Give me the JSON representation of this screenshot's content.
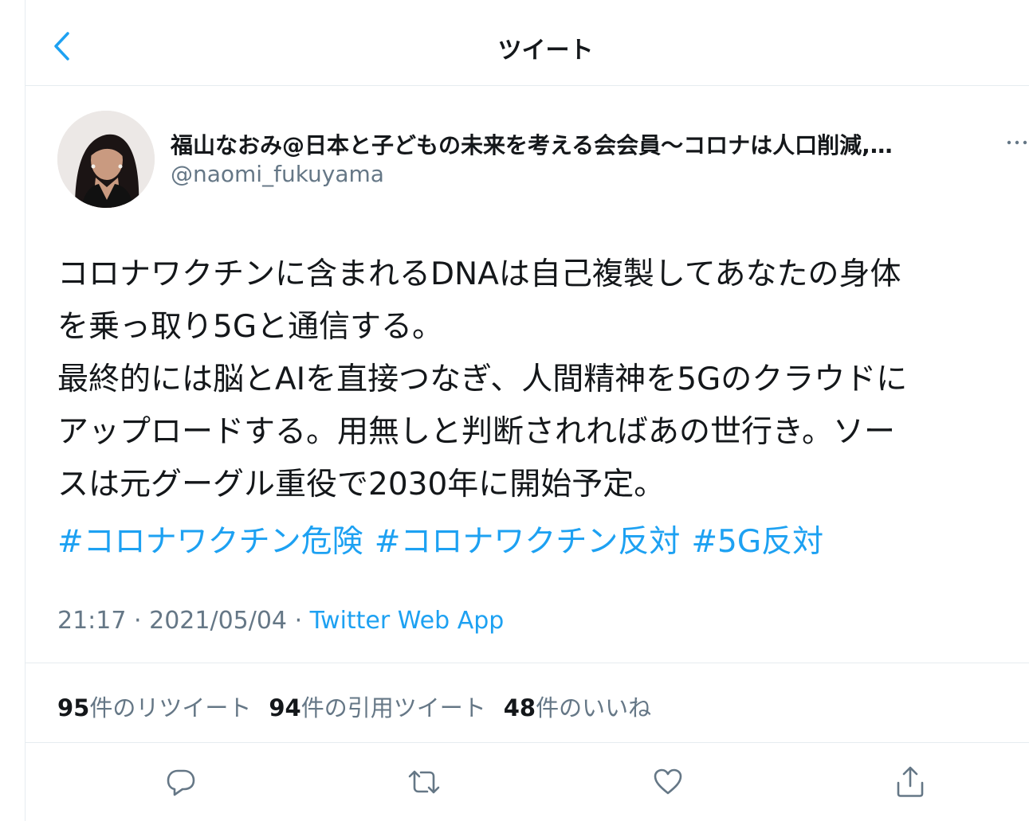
{
  "header": {
    "title": "ツイート",
    "back_icon": "chevron-left-icon"
  },
  "author": {
    "display_name": "福山なおみ@日本と子どもの未来を考える会会員〜コロナは人口削減,…",
    "handle": "@naomi_fukuyama",
    "more_icon": "more-dots-icon"
  },
  "tweet": {
    "lines": [
      "コロナワクチンに含まれるDNAは自己複製してあなたの身体",
      "を乗っ取り5Gと通信する。",
      "最終的には脳とAIを直接つなぎ、人間精神を5Gのクラウドに",
      "アップロードする。用無しと判断されればあの世行き。ソー",
      "スは元グーグル重役で2030年に開始予定。"
    ],
    "hashtags": [
      "#コロナワクチン危険",
      "#コロナワクチン反対",
      "#5G反対"
    ],
    "time": "21:17",
    "date": "2021/05/04",
    "separator": "·",
    "source": "Twitter Web App"
  },
  "stats": {
    "retweets_count": "95",
    "retweets_label": "件のリツイート",
    "quotes_count": "94",
    "quotes_label": "件の引用ツイート",
    "likes_count": "48",
    "likes_label": "件のいいね"
  },
  "actions": {
    "reply_icon": "reply-icon",
    "retweet_icon": "retweet-icon",
    "like_icon": "heart-icon",
    "share_icon": "share-icon"
  },
  "colors": {
    "accent": "#1da1f2",
    "text": "#14171a",
    "muted": "#657786",
    "border": "#e6ecf0"
  }
}
